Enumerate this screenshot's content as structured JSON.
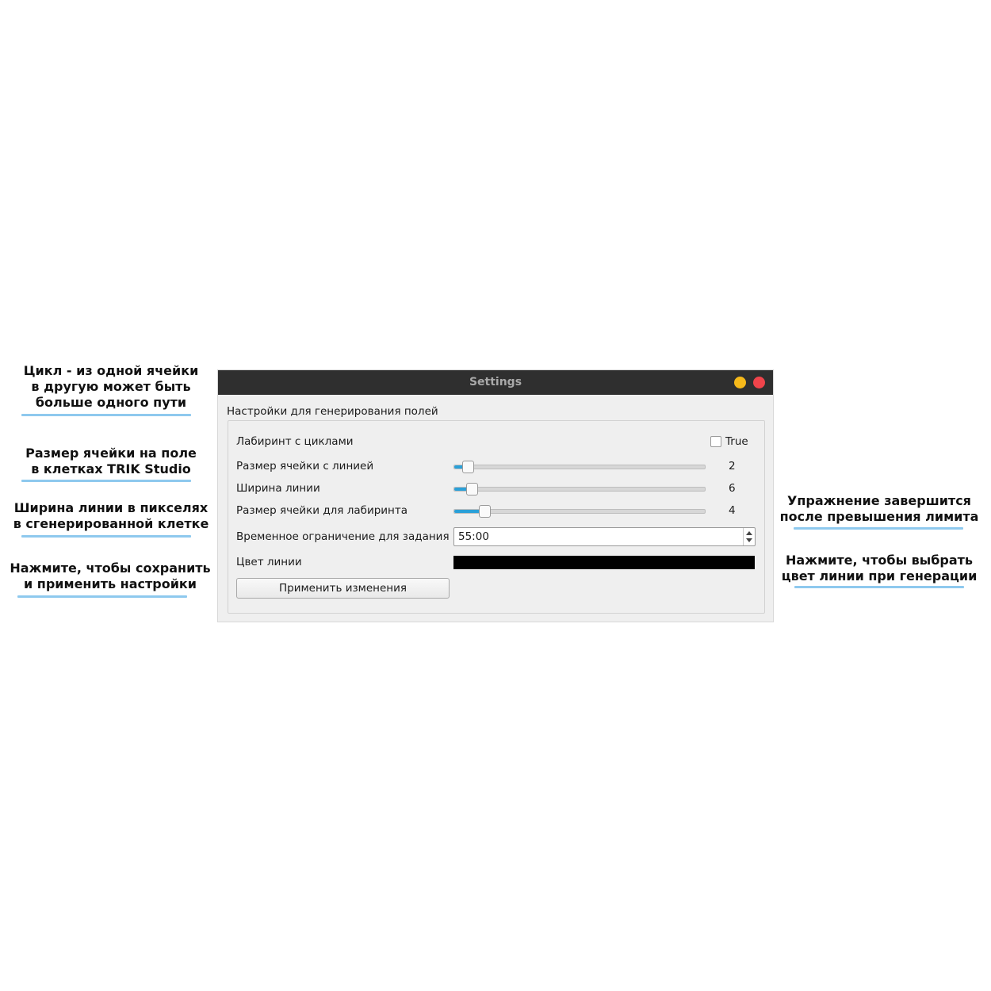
{
  "window": {
    "title": "Settings"
  },
  "group": {
    "title": "Настройки для генерирования полей"
  },
  "settings": {
    "loops_label": "Лабиринт с циклами",
    "loops_checkbox_text": "True",
    "loops_checked": false,
    "cell_size_label": "Размер ячейки с линией",
    "cell_size_value": "2",
    "line_width_label": "Ширина линии",
    "line_width_value": "6",
    "maze_cell_label": "Размер ячейки для лабиринта",
    "maze_cell_value": "4",
    "time_limit_label": "Временное ограничение для задания",
    "time_limit_value": "55:00",
    "line_color_label": "Цвет линии",
    "line_color": "#000000",
    "apply_button": "Применить изменения"
  },
  "annotations": {
    "a1": [
      "Цикл - из одной ячейки",
      "в другую может быть",
      "больше одного пути"
    ],
    "a2": [
      "Размер ячейки на поле",
      "в клетках TRIK Studio"
    ],
    "a3": [
      "Ширина линии в пикселях",
      "в сгенерированной клетке"
    ],
    "a4": [
      "Нажмите, чтобы сохранить",
      "и применить настройки"
    ],
    "a5": [
      "Упражнение завершится",
      "после превышения лимита"
    ],
    "a6": [
      "Нажмите, чтобы выбрать",
      "цвет линии при генерации"
    ]
  },
  "colors": {
    "accent": "#2aa0d8",
    "underline": "#8ec9ee",
    "titlebar": "#2f2f2f"
  }
}
